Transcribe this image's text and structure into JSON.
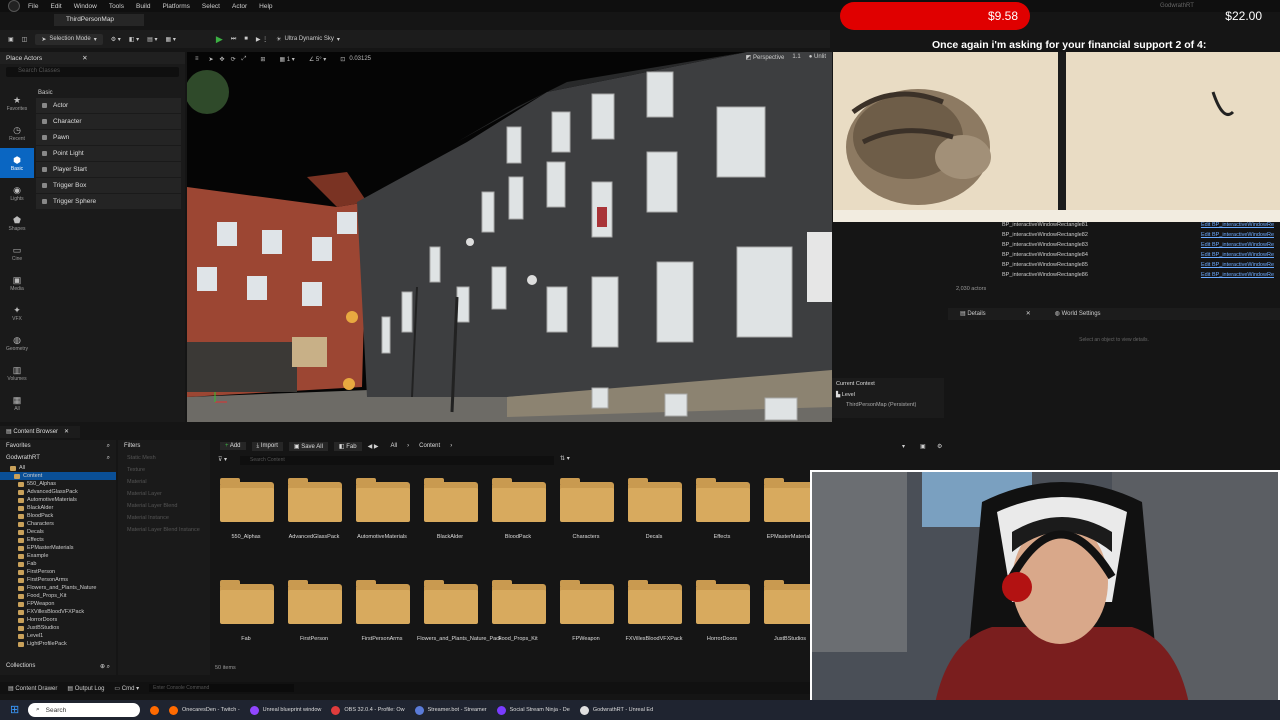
{
  "app": {
    "menus": [
      "File",
      "Edit",
      "Window",
      "Tools",
      "Build",
      "Platforms",
      "Select",
      "Actor",
      "Help"
    ],
    "map_tab": "ThirdPersonMap",
    "toolbar": {
      "mode": "Selection Mode",
      "sky": "Ultra Dynamic Sky"
    }
  },
  "place_actors": {
    "title": "Place Actors",
    "search_placeholder": "Search Classes",
    "section": "Basic",
    "categories": [
      "Favorites",
      "Recent",
      "Basic",
      "Lights",
      "Shapes",
      "Cine",
      "Media",
      "VFX",
      "Geometry",
      "Volumes",
      "All"
    ],
    "items": [
      "Actor",
      "Character",
      "Pawn",
      "Point Light",
      "Player Start",
      "Trigger Box",
      "Trigger Sphere"
    ]
  },
  "viewport": {
    "view_mode": "Perspective",
    "lit_mode": "Unlit",
    "value": "0.03125",
    "scale": "1.1"
  },
  "outliner": {
    "rows": [
      {
        "name": "BP_interactiveWindowRectangle81",
        "link": "Edit BP_interactiveWindowRe"
      },
      {
        "name": "BP_interactiveWindowRectangle82",
        "link": "Edit BP_interactiveWindowRe"
      },
      {
        "name": "BP_interactiveWindowRectangle83",
        "link": "Edit BP_interactiveWindowRe"
      },
      {
        "name": "BP_interactiveWindowRectangle84",
        "link": "Edit BP_interactiveWindowRe"
      },
      {
        "name": "BP_interactiveWindowRectangle85",
        "link": "Edit BP_interactiveWindowRe"
      },
      {
        "name": "BP_interactiveWindowRectangle86",
        "link": "Edit BP_interactiveWindowRe"
      }
    ],
    "count": "2,030 actors"
  },
  "details": {
    "tab_details": "Details",
    "tab_world": "World Settings",
    "empty_message": "Select an object to view details."
  },
  "context": {
    "title": "Current Context",
    "level": "Level",
    "persistent": "ThirdPersonMap (Persistent)"
  },
  "content_browser": {
    "tab": "Content Browser",
    "favorites": "Favorites",
    "project": "GodwrathRT",
    "tree": [
      "All",
      "Content",
      "550_Alphas",
      "AdvancedGlassPack",
      "AutomotiveMaterials",
      "BlackAlder",
      "BloodPack",
      "Characters",
      "Decals",
      "Effects",
      "EPMasterMaterials",
      "Example",
      "Fab",
      "FirstPerson",
      "FirstPersonArms",
      "Flowers_and_Plants_Nature",
      "Food_Props_Kit",
      "FPWeapon",
      "FXVillesBloodVFXPack",
      "HorrorDoors",
      "JustBStudios",
      "Level1",
      "LightProfilePack"
    ],
    "collections": "Collections",
    "filters_title": "Filters",
    "filters": [
      "Static Mesh",
      "Texture",
      "Material",
      "Material Layer",
      "Material Layer Blend",
      "Material Instance",
      "Material Layer Blend Instance"
    ],
    "toolbar": {
      "add": "Add",
      "import": "Import",
      "save_all": "Save All",
      "fab": "Fab"
    },
    "path": [
      "All",
      "Content"
    ],
    "search_placeholder": "Search Content",
    "folders_row1": [
      "550_Alphas",
      "AdvancedGlassPack",
      "AutomotiveMaterials",
      "BlackAlder",
      "BloodPack",
      "Characters",
      "Decals",
      "Effects",
      "EPMasterMaterials"
    ],
    "folders_row2": [
      "Fab",
      "FirstPerson",
      "FirstPersonArms",
      "Flowers_and_Plants_Nature_Pack",
      "Food_Props_Kit",
      "FPWeapon",
      "FXVillesBloodVFXPack",
      "HorrorDoors",
      "JustBStudios"
    ],
    "item_count": "50 items"
  },
  "status_bar": {
    "content_drawer": "Content Drawer",
    "output_log": "Output Log",
    "cmd": "Cmd",
    "console_placeholder": "Enter Console Command"
  },
  "overlay": {
    "donation_current": "$9.58",
    "donation_goal": "$22.00",
    "user": "GodwrathRT",
    "banner": "Once again i'm asking for your financial support 2 of 4:"
  },
  "taskbar": {
    "search": "Search",
    "apps": [
      "OnecaresDen - Twitch -",
      "Unreal blueprint window",
      "OBS 32.0.4 - Profile: Ow",
      "Streamer.bot - Streamer",
      "Social Stream Ninja - De",
      "GodwrathRT - Unreal Ed"
    ]
  },
  "colors": {
    "accent": "#0a66c2",
    "donation": "#e00000",
    "folder": "#d8aa5e"
  }
}
